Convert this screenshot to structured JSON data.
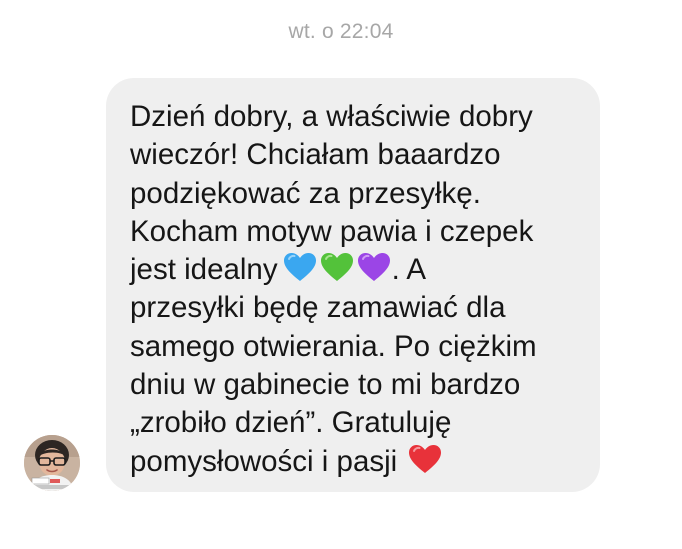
{
  "conversation": {
    "timestamp": "wt. o 22:04"
  },
  "message": {
    "text_part1": "Dzień dobry, a właściwie dobry\nwieczór! Chciałam baaardzo\npodziękować za przesyłkę.\nKocham motyw pawia i czepek\njest idealny",
    "hearts_after_part1": [
      "blue-heart-icon",
      "green-heart-icon",
      "purple-heart-icon"
    ],
    "text_part2": ". A\nprzesyłki będę zamawiać dla\nsamego otwierania. Po ciężkim\ndniu w gabinecie to mi bardzo\n„zrobiło dzień”. Gratuluję\npomysłowości i pasji",
    "hearts_after_part2": [
      "red-heart-icon"
    ]
  },
  "sender": {
    "avatar": "profile-photo"
  },
  "colors": {
    "bubble_background": "#efefef",
    "timestamp_text": "#a7a7a7",
    "message_text": "#161616",
    "blue_heart": "#3aa7f0",
    "green_heart": "#53c23a",
    "purple_heart": "#9b45e6",
    "red_heart": "#e8323a"
  }
}
